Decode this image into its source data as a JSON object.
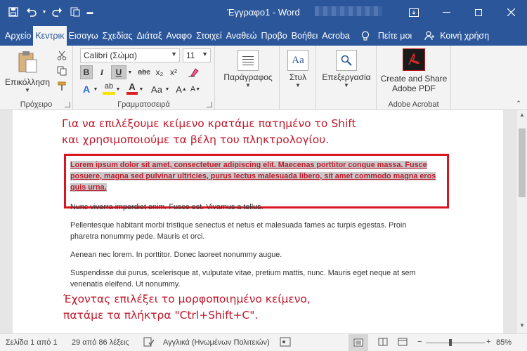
{
  "window": {
    "title": "Έγγραφο1 - Word"
  },
  "tabs": [
    "Αρχείο",
    "Κεντρική",
    "Εισαγωγή",
    "Σχεδίαση",
    "Διάταξη",
    "Αναφορές",
    "Στοιχεία",
    "Αναθεώρηση",
    "Προβολή",
    "Βοήθεια",
    "Acrobat"
  ],
  "tab_labels_visible": [
    "Αρχείο",
    "Κεντρικ",
    "Εισαγω",
    "Σχεδίας",
    "Διάταξ",
    "Αναφο",
    "Στοιχεί",
    "Αναθεώ",
    "Προβο",
    "Βοήθει",
    "Acroba"
  ],
  "tell_me": "Πείτε μοι",
  "share": "Κοινή χρήση",
  "ribbon": {
    "clipboard": {
      "paste": "Επικόλληση",
      "label": "Πρόχειρο"
    },
    "font": {
      "name": "Calibri (Σώμα)",
      "size": "11",
      "label": "Γραμματοσειρά",
      "bold": "B",
      "italic": "I",
      "underline": "U",
      "strike": "abc",
      "sub": "x₂",
      "sup": "x²",
      "textfx": "A",
      "highlight": "ab",
      "color": "A",
      "aa": "Aa"
    },
    "paragraph": {
      "label": "Παράγραφος"
    },
    "styles": {
      "label": "Στυλ"
    },
    "editing": {
      "label": "Επεξεργασία"
    },
    "acrobat": {
      "create": "Create and Share",
      "create2": "Adobe PDF",
      "label": "Adobe Acrobat"
    }
  },
  "document": {
    "caption_top": [
      "Για να επιλέξουμε κείμενο κρατάμε πατημένο το Shift",
      "και χρησιμοποιούμε τα βέλη του πληκτρολογίου."
    ],
    "selected_lines": [
      "Lorem ipsum dolor sit amet, consectetuer adipiscing elit. Maecenas porttitor congue massa. Fusce",
      "posuere, magna sed pulvinar ultricies, purus lectus malesuada libero, sit amet commodo magna eros",
      "quis urna."
    ],
    "paragraphs": [
      [
        "Nunc viverra imperdiet enim. Fusce est. Vivamus a tellus."
      ],
      [
        "Pellentesque habitant morbi tristique senectus et netus et malesuada fames ac turpis egestas. Proin",
        "pharetra nonummy pede. Mauris et orci."
      ],
      [
        "Aenean nec lorem. In porttitor. Donec laoreet nonummy augue."
      ],
      [
        "Suspendisse dui purus, scelerisque at, vulputate vitae, pretium mattis, nunc. Mauris eget neque at sem",
        "venenatis eleifend. Ut nonummy."
      ]
    ],
    "caption_bottom": [
      "Έχοντας επιλέξει το μορφοποιημένο κείμενο,",
      "πατάμε τα πλήκτρα \"Ctrl+Shift+C\"."
    ]
  },
  "status": {
    "page": "Σελίδα 1 από 1",
    "words": "29 από 86 λέξεις",
    "language": "Αγγλικά (Ηνωμένων Πολιτειών)",
    "zoom": "85%",
    "zoom_level": 0.85
  },
  "colors": {
    "brand": "#2b579a",
    "annotation": "#c0192b",
    "box": "#d9151f"
  }
}
